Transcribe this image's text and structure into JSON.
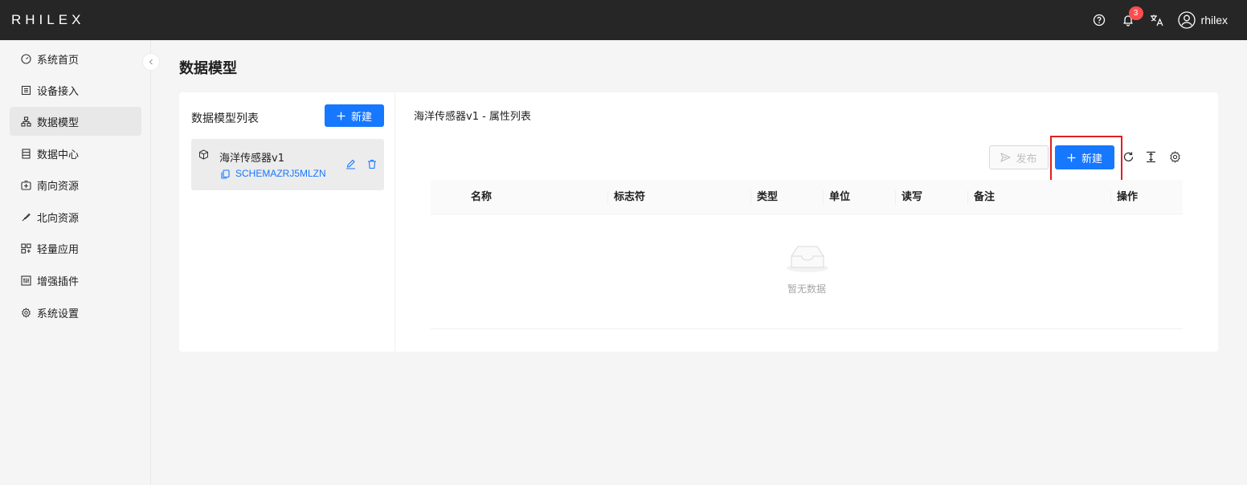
{
  "header": {
    "logo": "RHILEX",
    "notification_count": "3",
    "username": "rhilex",
    "icons": [
      "help-icon",
      "bell-icon",
      "translate-icon",
      "user-icon"
    ]
  },
  "sidebar": {
    "items": [
      {
        "label": "系统首页",
        "icon": "dashboard-icon"
      },
      {
        "label": "设备接入",
        "icon": "device-icon"
      },
      {
        "label": "数据模型",
        "icon": "model-icon",
        "active": true
      },
      {
        "label": "数据中心",
        "icon": "database-icon"
      },
      {
        "label": "南向资源",
        "icon": "southbound-icon"
      },
      {
        "label": "北向资源",
        "icon": "northbound-icon"
      },
      {
        "label": "轻量应用",
        "icon": "apps-icon"
      },
      {
        "label": "增强插件",
        "icon": "plugin-icon"
      },
      {
        "label": "系统设置",
        "icon": "settings-icon"
      }
    ]
  },
  "page": {
    "title": "数据模型"
  },
  "model_list": {
    "title": "数据模型列表",
    "new_label": "新建",
    "items": [
      {
        "name": "海洋传感器v1",
        "id": "SCHEMAZRJ5MLZN"
      }
    ]
  },
  "properties": {
    "title": "海洋传感器v1 - 属性列表",
    "publish_label": "发布",
    "new_label": "新建",
    "columns": [
      "名称",
      "标志符",
      "类型",
      "单位",
      "读写",
      "备注",
      "操作"
    ],
    "empty_text": "暂无数据"
  },
  "colors": {
    "primary": "#1677ff",
    "header_bg": "#262626",
    "badge": "#ff4d4f",
    "highlight": "#e02020"
  }
}
